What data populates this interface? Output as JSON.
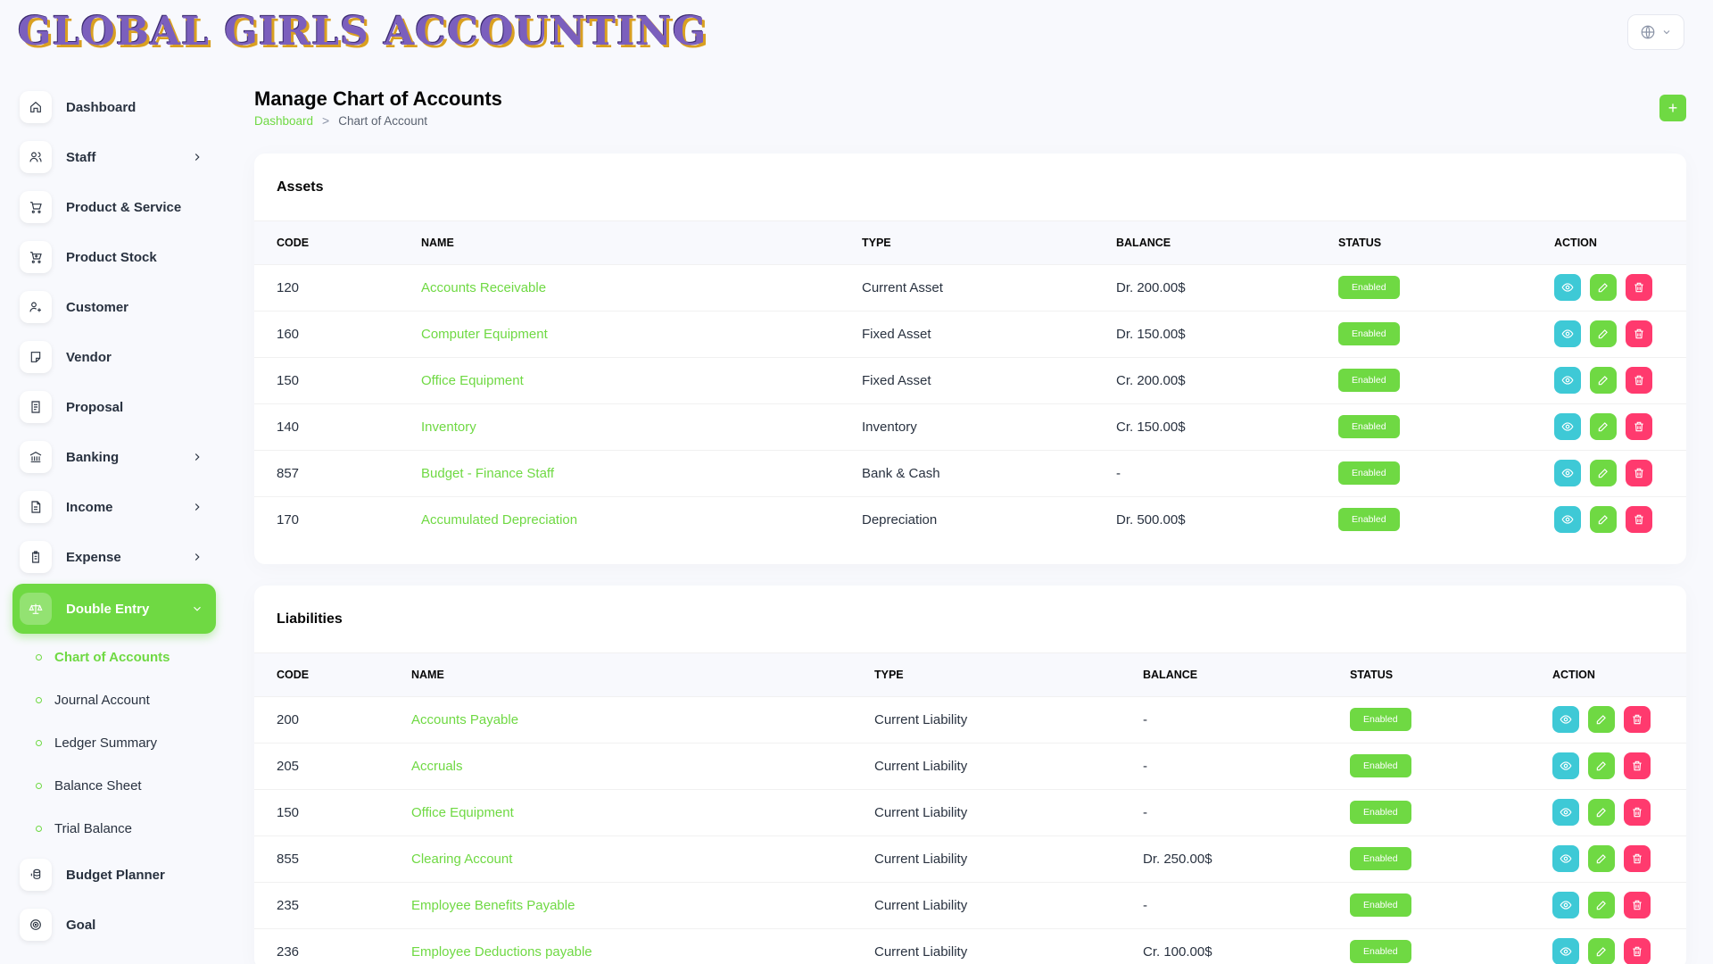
{
  "brand": {
    "logo_text": "GLOBAL GIRLS ACCOUNTING"
  },
  "header": {
    "lang_icon": "globe-icon"
  },
  "sidebar": {
    "items": [
      {
        "label": "Dashboard",
        "icon": "home-icon"
      },
      {
        "label": "Staff",
        "icon": "users-icon",
        "has_children": true
      },
      {
        "label": "Product & Service",
        "icon": "cart-icon"
      },
      {
        "label": "Product Stock",
        "icon": "cart-plus-icon"
      },
      {
        "label": "Customer",
        "icon": "user-plus-icon"
      },
      {
        "label": "Vendor",
        "icon": "note-icon"
      },
      {
        "label": "Proposal",
        "icon": "receipt-icon"
      },
      {
        "label": "Banking",
        "icon": "building-bank-icon",
        "has_children": true
      },
      {
        "label": "Income",
        "icon": "file-invoice-icon",
        "has_children": true
      },
      {
        "label": "Expense",
        "icon": "clipboard-icon",
        "has_children": true
      },
      {
        "label": "Double Entry",
        "icon": "scale-icon",
        "active": true,
        "expanded": true
      }
    ],
    "sub_items": [
      {
        "label": "Chart of Accounts",
        "active": true
      },
      {
        "label": "Journal Account"
      },
      {
        "label": "Ledger Summary"
      },
      {
        "label": "Balance Sheet"
      },
      {
        "label": "Trial Balance"
      }
    ],
    "items_after": [
      {
        "label": "Budget Planner",
        "icon": "coins-icon"
      },
      {
        "label": "Goal",
        "icon": "target-icon"
      }
    ]
  },
  "page": {
    "title": "Manage Chart of Accounts",
    "breadcrumb": {
      "home": "Dashboard",
      "separator": ">",
      "current": "Chart of Account"
    },
    "add_button": "+"
  },
  "columns": [
    "Code",
    "Name",
    "Type",
    "Balance",
    "Status",
    "Action"
  ],
  "sections": [
    {
      "title": "Assets",
      "rows": [
        {
          "code": "120",
          "name": "Accounts Receivable",
          "type": "Current Asset",
          "balance": "Dr. 200.00$",
          "status": "Enabled"
        },
        {
          "code": "160",
          "name": "Computer Equipment",
          "type": "Fixed Asset",
          "balance": "Dr. 150.00$",
          "status": "Enabled"
        },
        {
          "code": "150",
          "name": "Office Equipment",
          "type": "Fixed Asset",
          "balance": "Cr. 200.00$",
          "status": "Enabled"
        },
        {
          "code": "140",
          "name": "Inventory",
          "type": "Inventory",
          "balance": "Cr. 150.00$",
          "status": "Enabled"
        },
        {
          "code": "857",
          "name": "Budget - Finance Staff",
          "type": "Bank & Cash",
          "balance": "-",
          "status": "Enabled"
        },
        {
          "code": "170",
          "name": "Accumulated Depreciation",
          "type": "Depreciation",
          "balance": "Dr. 500.00$",
          "status": "Enabled"
        }
      ]
    },
    {
      "title": "Liabilities",
      "rows": [
        {
          "code": "200",
          "name": "Accounts Payable",
          "type": "Current Liability",
          "balance": "-",
          "status": "Enabled"
        },
        {
          "code": "205",
          "name": "Accruals",
          "type": "Current Liability",
          "balance": "-",
          "status": "Enabled"
        },
        {
          "code": "150",
          "name": "Office Equipment",
          "type": "Current Liability",
          "balance": "-",
          "status": "Enabled"
        },
        {
          "code": "855",
          "name": "Clearing Account",
          "type": "Current Liability",
          "balance": "Dr. 250.00$",
          "status": "Enabled"
        },
        {
          "code": "235",
          "name": "Employee Benefits Payable",
          "type": "Current Liability",
          "balance": "-",
          "status": "Enabled"
        },
        {
          "code": "236",
          "name": "Employee Deductions payable",
          "type": "Current Liability",
          "balance": "Cr. 100.00$",
          "status": "Enabled"
        }
      ]
    }
  ],
  "colors": {
    "accent": "#6fd943",
    "view": "#3ec9d6",
    "delete": "#ff3a6e"
  }
}
